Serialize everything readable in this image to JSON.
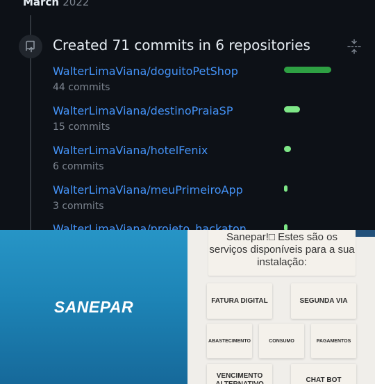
{
  "github": {
    "month": "March",
    "year": "2022",
    "summary": "Created 71 commits in 6 repositories",
    "repos": [
      {
        "name": "WalterLimaViana/doguitoPetShop",
        "commits": "44 commits",
        "share": 1.0
      },
      {
        "name": "WalterLimaViana/destinoPraiaSP",
        "commits": "15 commits",
        "share": 0.34
      },
      {
        "name": "WalterLimaViana/hotelFenix",
        "commits": "6 commits",
        "share": 0.14
      },
      {
        "name": "WalterLimaViana/meuPrimeiroApp",
        "commits": "3 commits",
        "share": 0.07
      },
      {
        "name": "WalterLimaViana/projeto_hackaton",
        "commits": "",
        "share": 0.05
      }
    ],
    "colors": {
      "background": "#0d1117",
      "link": "#4493f8",
      "bar": "#2ea043",
      "bar_light": "#7ee787"
    },
    "icons": {
      "badge": "repo-push-icon",
      "collapse": "fold-icon"
    }
  },
  "sanepar_splash": {
    "logo": "SANEPAR",
    "colors": {
      "top": "#2795c6",
      "bottom": "#16699a"
    }
  },
  "services": {
    "message": "Sanepar!□ Estes são os serviços disponíveis para a sua instalação:",
    "buttons": {
      "fatura": "FATURA DIGITAL",
      "segunda_via": "SEGUNDA VIA",
      "abastecimento": "ABASTECIMENTO",
      "consumo": "CONSUMO",
      "pagamentos": "PAGAMENTOS",
      "vencimento": "VENCIMENTO ALTERNATIVO",
      "chat_bot": "CHAT BOT"
    }
  }
}
